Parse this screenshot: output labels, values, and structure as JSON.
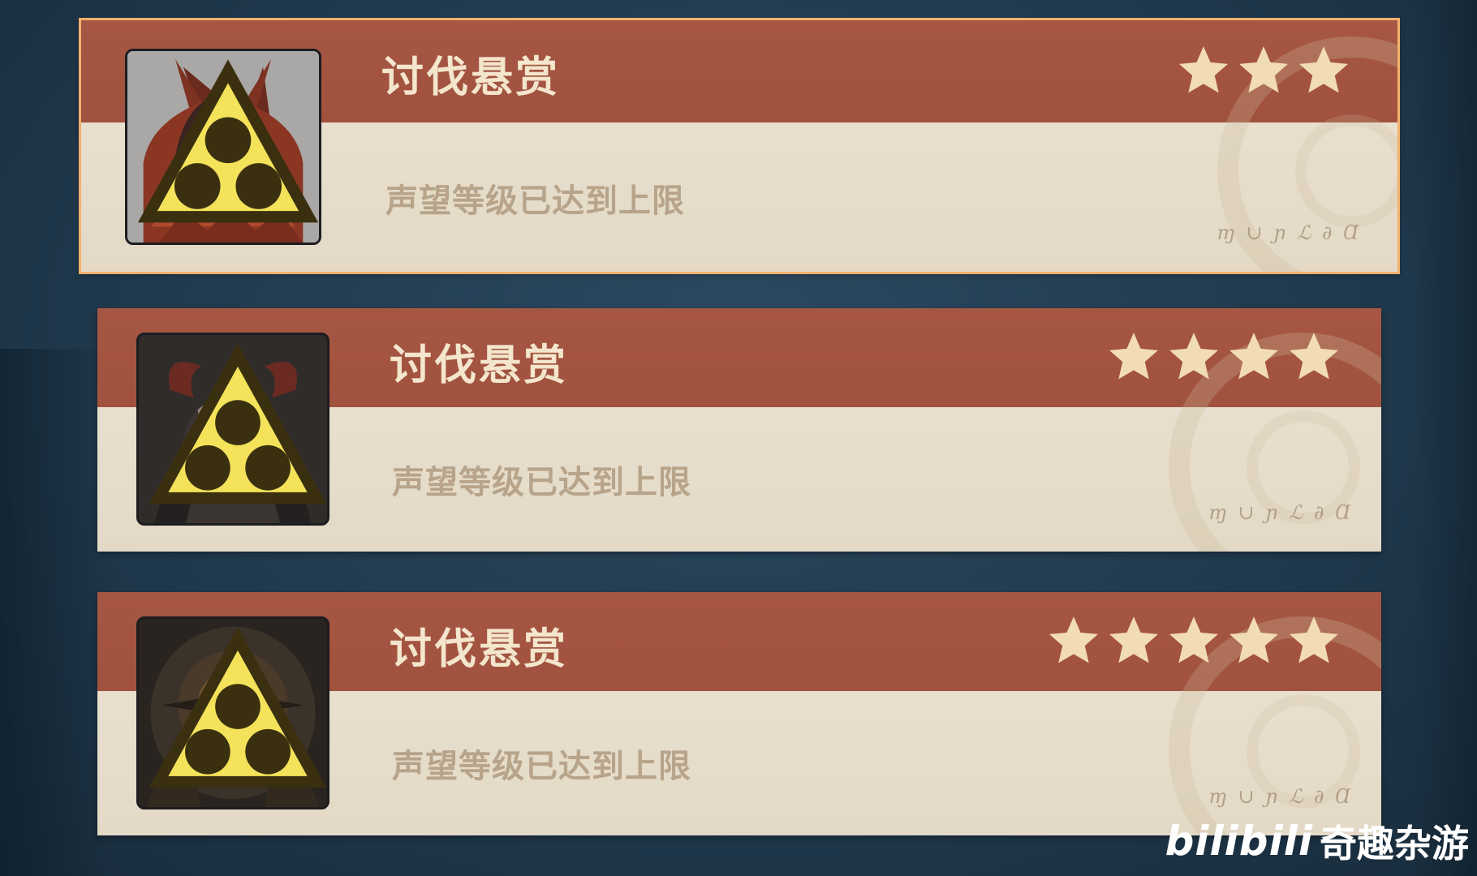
{
  "bounties": [
    {
      "title": "讨伐悬赏",
      "status": "声望等级已达到上限",
      "stars": 3,
      "selected": true,
      "script_text": "ɱ ∪ ɲ ℒ ∂ Ɑ",
      "portrait": "hooded-monster-portrait"
    },
    {
      "title": "讨伐悬赏",
      "status": "声望等级已达到上限",
      "stars": 4,
      "selected": false,
      "script_text": "ɱ ∪ ɲ ℒ ∂ Ɑ",
      "portrait": "horned-mask-portrait"
    },
    {
      "title": "讨伐悬赏",
      "status": "声望等级已达到上限",
      "stars": 5,
      "selected": false,
      "script_text": "ɱ ∪ ɲ ℒ ∂ Ɑ",
      "portrait": "armored-core-portrait"
    }
  ],
  "watermark": {
    "logo": "bilibili",
    "channel": "奇趣杂游"
  },
  "colors": {
    "band": "#a65743",
    "card": "#e8dfcf",
    "title": "#f3e6cd",
    "star": "#f2dcb4",
    "status": "#b7a48a",
    "selected_border": "#f2b26e"
  }
}
